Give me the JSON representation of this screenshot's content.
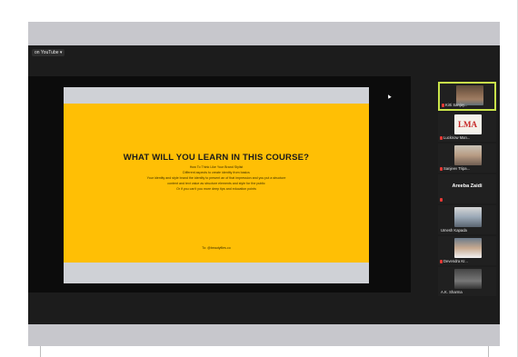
{
  "youtube_label": "on YouTube ▾",
  "slide": {
    "title": "WHAT WILL YOU LEARN IN THIS COURSE?",
    "lines": [
      "How To Think Like Your Brand Stylist",
      "Different aspects to create identity from basics",
      "Your identity and style brand the identity to present an of that impression and you put a structure",
      "content and text value as structure elements and style for the public",
      "Or if you can't you more deep tips and education points"
    ],
    "credit": "To: @beautyfiles.co"
  },
  "participants": [
    {
      "name": "Kirti Sanjay..."
    },
    {
      "name": "Lucknow Man..."
    },
    {
      "name": "Sanjeev Tripa..."
    },
    {
      "name": "Areeba Zaidi"
    },
    {
      "name": "Umesh Kapada"
    },
    {
      "name": "Devendra Kr..."
    },
    {
      "name": "A.K. Sharma"
    }
  ],
  "icons": {
    "mic": "mic-muted-icon",
    "cursor": "cursor-icon"
  },
  "colors": {
    "slide_yellow": "#ffbf05",
    "active_border": "#c9e34a",
    "muted_mic": "#e53935"
  }
}
